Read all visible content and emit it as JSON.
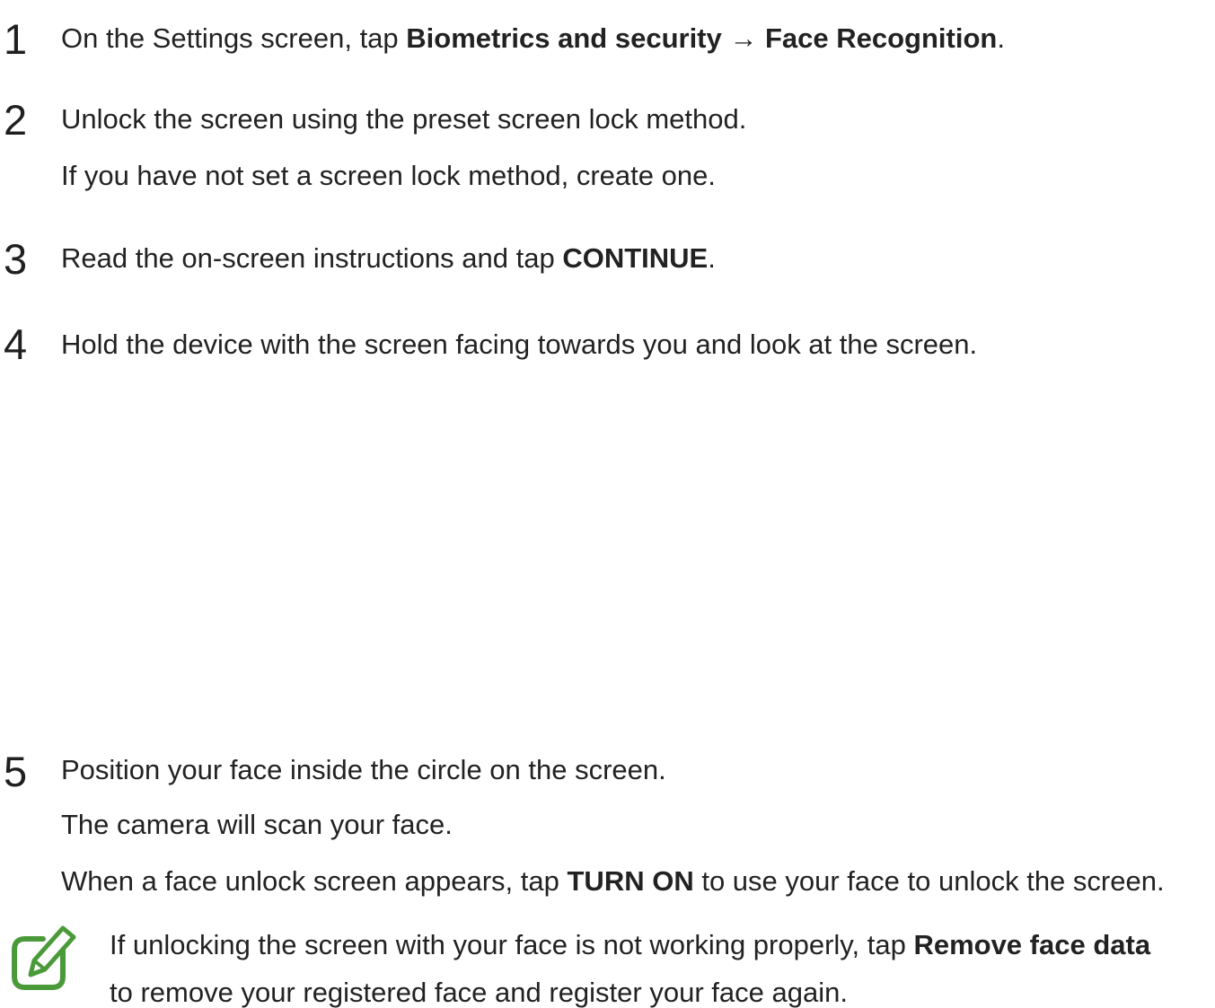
{
  "steps": [
    {
      "number": "1",
      "lines": [
        [
          {
            "text": "On the Settings screen, tap ",
            "bold": false
          },
          {
            "text": "Biometrics and security",
            "bold": true
          },
          {
            "text": " → ",
            "bold": false
          },
          {
            "text": "Face Recognition",
            "bold": true
          },
          {
            "text": ".",
            "bold": false
          }
        ]
      ]
    },
    {
      "number": "2",
      "lines": [
        [
          {
            "text": "Unlock the screen using the preset screen lock method.",
            "bold": false
          }
        ],
        [
          {
            "text": "If you have not set a screen lock method, create one.",
            "bold": false
          }
        ]
      ]
    },
    {
      "number": "3",
      "lines": [
        [
          {
            "text": "Read the on-screen instructions and tap ",
            "bold": false
          },
          {
            "text": "CONTINUE",
            "bold": true
          },
          {
            "text": ".",
            "bold": false
          }
        ]
      ]
    },
    {
      "number": "4",
      "lines": [
        [
          {
            "text": "Hold the device with the screen facing towards you and look at the screen.",
            "bold": false
          }
        ]
      ]
    },
    {
      "number": "5",
      "lines": [
        [
          {
            "text": "Position your face inside the circle on the screen.",
            "bold": false
          }
        ],
        [
          {
            "text": "The camera will scan your face.",
            "bold": false
          }
        ],
        [
          {
            "text": "When a face unlock screen appears, tap ",
            "bold": false
          },
          {
            "text": "TURN ON",
            "bold": true
          },
          {
            "text": " to use your face to unlock the screen.",
            "bold": false
          }
        ]
      ]
    }
  ],
  "note": {
    "icon": "note-pencil-icon",
    "icon_color": "#4a9a3a",
    "lines": [
      [
        {
          "text": "If unlocking the screen with your face is not working properly, tap ",
          "bold": false
        },
        {
          "text": "Remove face data",
          "bold": true
        }
      ],
      [
        {
          "text": "to remove your registered face and register your face again.",
          "bold": false
        }
      ]
    ]
  }
}
